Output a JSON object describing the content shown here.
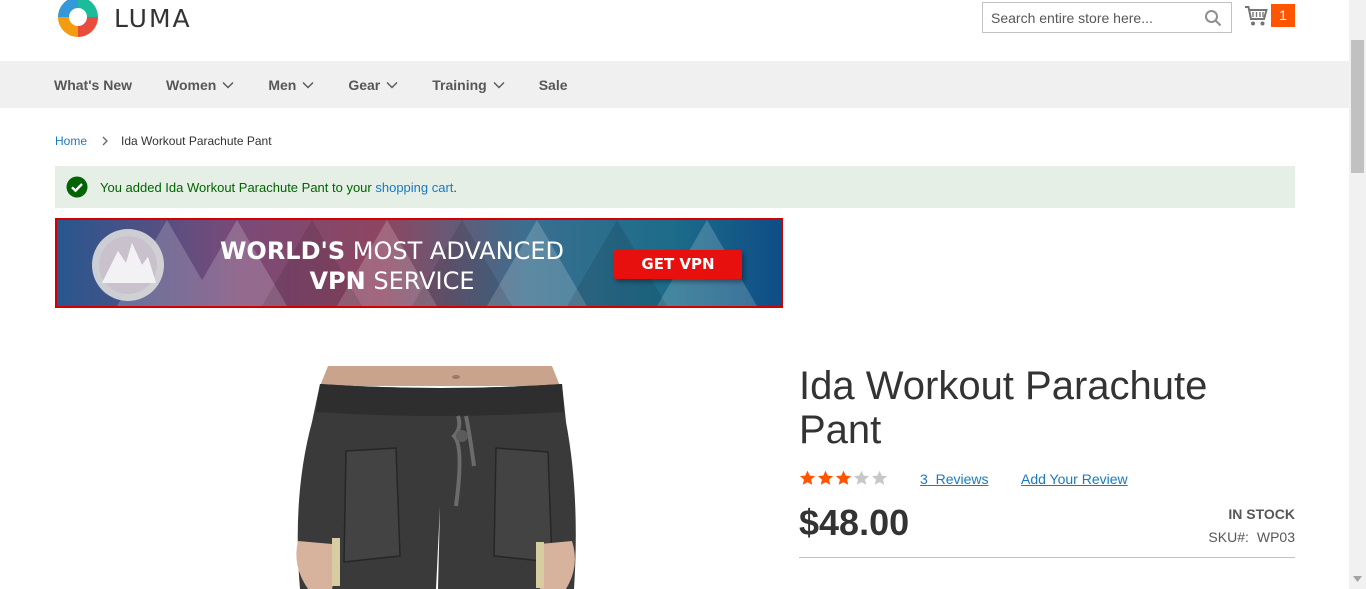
{
  "header": {
    "logo_text": "LUMA",
    "search_placeholder": "Search entire store here...",
    "cart_count": "1",
    "icons": [
      "search-icon",
      "cart-icon"
    ]
  },
  "nav": {
    "items": [
      {
        "label": "What's New",
        "has_dropdown": false
      },
      {
        "label": "Women",
        "has_dropdown": true
      },
      {
        "label": "Men",
        "has_dropdown": true
      },
      {
        "label": "Gear",
        "has_dropdown": true
      },
      {
        "label": "Training",
        "has_dropdown": true
      },
      {
        "label": "Sale",
        "has_dropdown": false
      }
    ]
  },
  "breadcrumb": {
    "home": "Home",
    "current": "Ida Workout Parachute Pant"
  },
  "message": {
    "prefix": "You added Ida Workout Parachute Pant to your ",
    "link": "shopping cart",
    "suffix": "."
  },
  "ad": {
    "headline_bold_1": "WORLD'S",
    "headline_rest_1": " MOST ADVANCED",
    "headline_bold_2": "VPN",
    "headline_rest_2": " SERVICE",
    "button": "GET VPN"
  },
  "product": {
    "title": "Ida Workout Parachute Pant",
    "rating_percent": 60,
    "reviews_count": "3",
    "reviews_label": "Reviews",
    "add_review": "Add Your Review",
    "price": "$48.00",
    "stock": "IN STOCK",
    "sku_label": "SKU#:",
    "sku": "WP03"
  },
  "colors": {
    "accent": "#1979c3",
    "cart_badge": "#ff5501",
    "nav_bg": "#f0f0f0",
    "success_bg": "#e5efe5",
    "star_filled": "#ff5501",
    "star_empty": "#c7c7c7",
    "ad_button": "#e8100f"
  }
}
